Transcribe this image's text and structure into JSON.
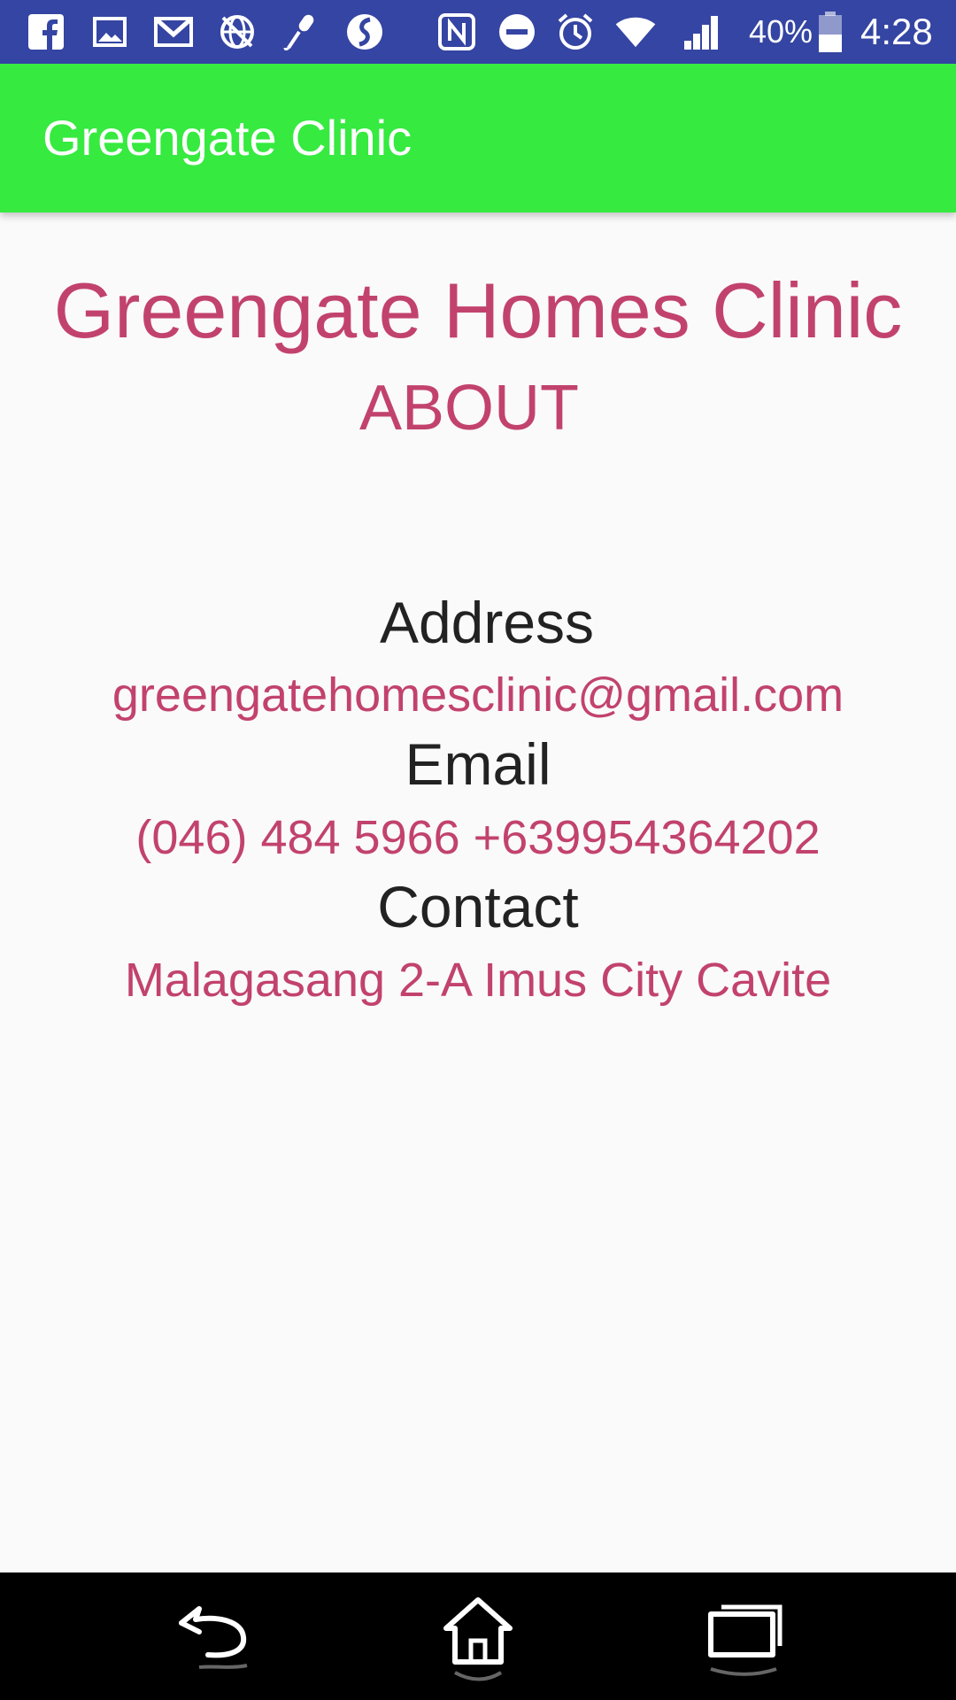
{
  "status_bar": {
    "icons": [
      "facebook-icon",
      "gallery-icon",
      "gmail-icon",
      "no-network-icon",
      "microphone-icon",
      "sync-app-icon",
      "nfc-icon",
      "do-not-disturb-icon",
      "alarm-icon",
      "wifi-icon",
      "signal-icon",
      "battery-icon"
    ],
    "battery": "40%",
    "time": "4:28"
  },
  "app_bar": {
    "title": "Greengate Clinic"
  },
  "main": {
    "clinic_name": "Greengate Homes Clinic",
    "section_title": "ABOUT",
    "address_label": "Address",
    "address_value": "greengatehomesclinic@gmail.com",
    "email_label": "Email",
    "email_value": "(046) 484 5966 +639954364202",
    "contact_label": "Contact",
    "contact_value": "Malagasang 2-A Imus City Cavite"
  },
  "nav_bar": {
    "buttons": [
      "back-icon",
      "home-icon",
      "recents-icon"
    ]
  },
  "colors": {
    "status_bar": "#3545a3",
    "app_bar": "#36ea40",
    "accent_text": "#c2426e",
    "label_text": "#222222",
    "background": "#fafafa",
    "nav_bar": "#000000"
  }
}
